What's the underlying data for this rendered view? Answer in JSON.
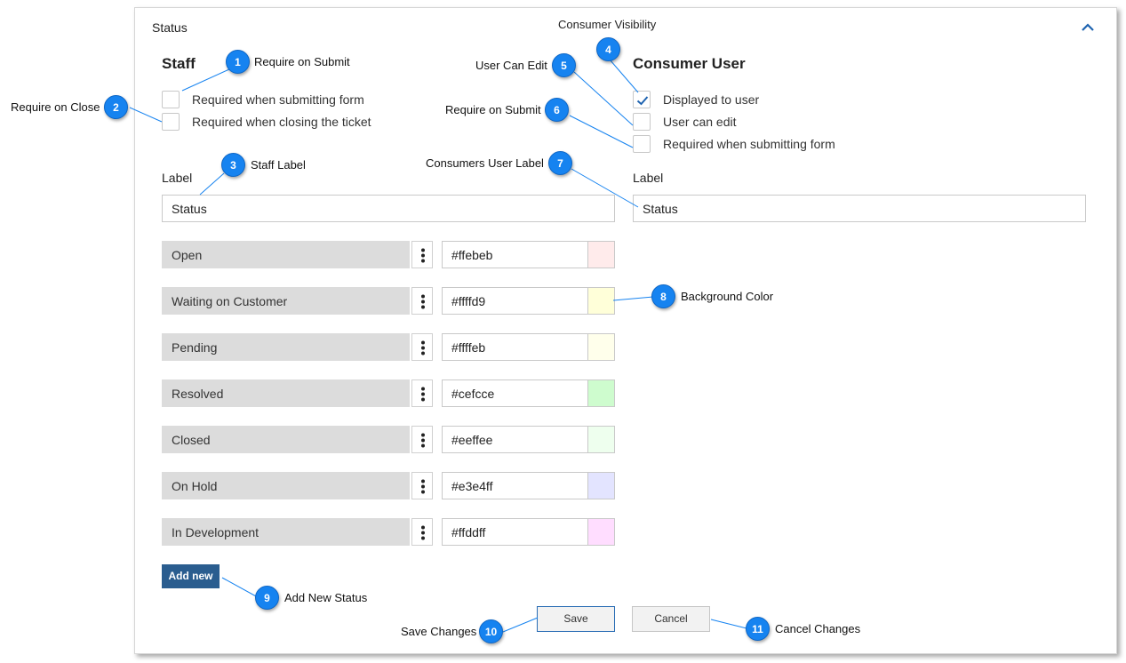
{
  "panel": {
    "title": "Status",
    "consumer_visibility": "Consumer Visibility",
    "collapse_icon": "chevron-up-icon"
  },
  "staff": {
    "title": "Staff",
    "checkboxes": [
      {
        "label": "Required when submitting form",
        "checked": false
      },
      {
        "label": "Required when closing the ticket",
        "checked": false
      }
    ],
    "label_caption": "Label",
    "label_value": "Status"
  },
  "consumer": {
    "title": "Consumer User",
    "checkboxes": [
      {
        "label": "Displayed to user",
        "checked": true
      },
      {
        "label": "User can edit",
        "checked": false
      },
      {
        "label": "Required when submitting form",
        "checked": false
      }
    ],
    "label_caption": "Label",
    "label_value": "Status"
  },
  "statuses": [
    {
      "name": "Open",
      "color": "#ffebeb"
    },
    {
      "name": "Waiting on Customer",
      "color": "#ffffd9"
    },
    {
      "name": "Pending",
      "color": "#ffffeb"
    },
    {
      "name": "Resolved",
      "color": "#cefcce"
    },
    {
      "name": "Closed",
      "color": "#eeffee"
    },
    {
      "name": "On Hold",
      "color": "#e3e4ff"
    },
    {
      "name": "In Development",
      "color": "#ffddff"
    }
  ],
  "buttons": {
    "add_new": "Add new",
    "save": "Save",
    "cancel": "Cancel"
  },
  "callouts": [
    {
      "num": "1",
      "text": "Require on Submit"
    },
    {
      "num": "2",
      "text": "Require on Close"
    },
    {
      "num": "3",
      "text": "Staff Label"
    },
    {
      "num": "4",
      "text": ""
    },
    {
      "num": "5",
      "text": "User Can Edit"
    },
    {
      "num": "6",
      "text": "Require on Submit"
    },
    {
      "num": "7",
      "text": "Consumers User Label"
    },
    {
      "num": "8",
      "text": "Background Color"
    },
    {
      "num": "9",
      "text": "Add New Status"
    },
    {
      "num": "10",
      "text": "Save Changes"
    },
    {
      "num": "11",
      "text": "Cancel Changes"
    }
  ],
  "colors": {
    "accent": "#2a5d8f",
    "callout_badge": "#1683f0",
    "callout_line": "#1683f0",
    "status_name_bg": "#dcdcdc"
  }
}
